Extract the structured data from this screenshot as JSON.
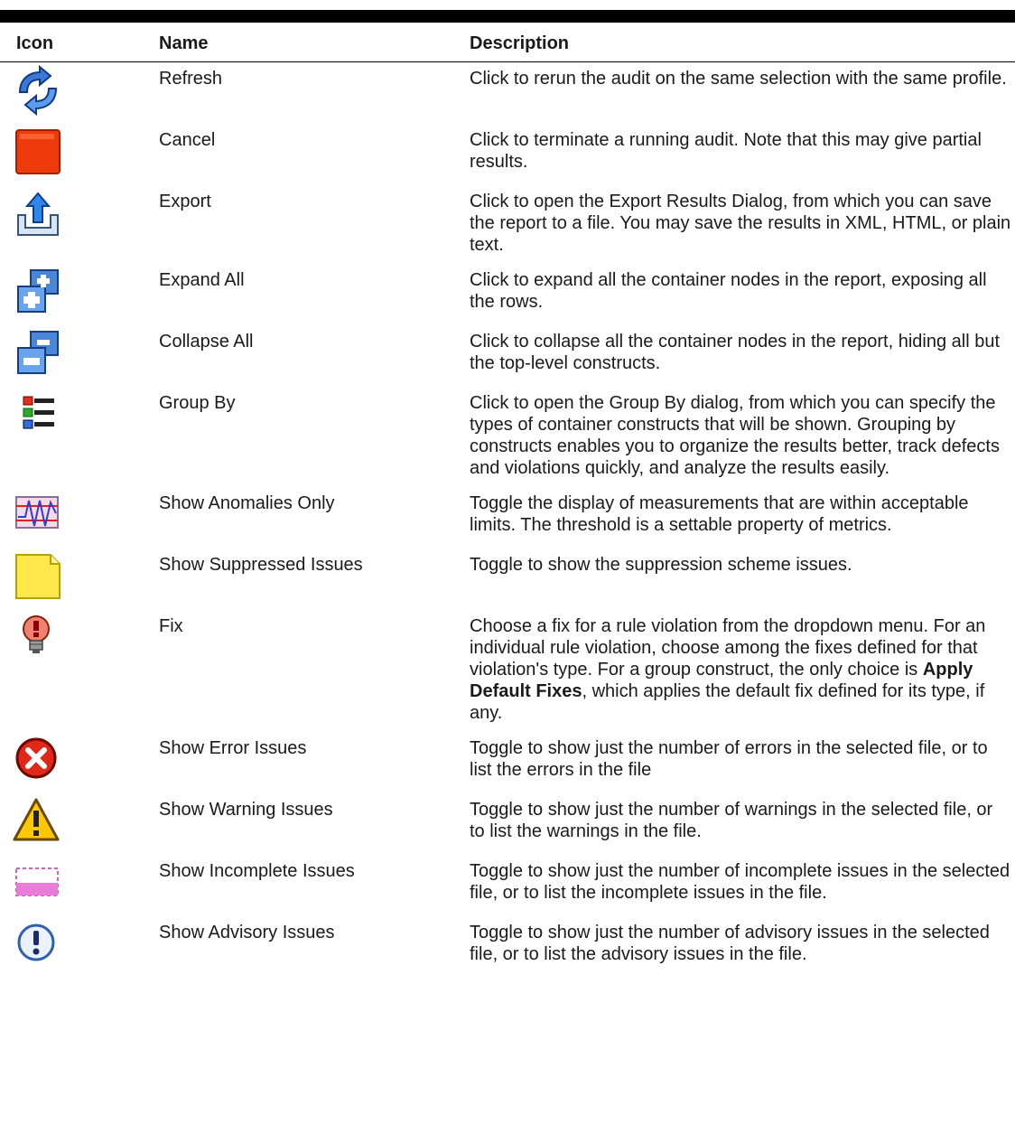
{
  "headers": {
    "icon": "Icon",
    "name": "Name",
    "description": "Description"
  },
  "rows": [
    {
      "icon": "refresh-icon",
      "name": "Refresh",
      "description": "Click to rerun the audit on the same selection with the same profile."
    },
    {
      "icon": "cancel-icon",
      "name": "Cancel",
      "description": "Click to terminate a running audit. Note that this may give partial results."
    },
    {
      "icon": "export-icon",
      "name": "Export",
      "description": "Click to open the Export Results Dialog, from which you can save the report to a file. You may save the results in XML, HTML, or plain text."
    },
    {
      "icon": "expand-all-icon",
      "name": "Expand All",
      "description": "Click to expand all the container nodes in the report, exposing all the rows."
    },
    {
      "icon": "collapse-all-icon",
      "name": "Collapse All",
      "description": "Click to collapse all the container nodes in the report, hiding all but the top-level constructs."
    },
    {
      "icon": "group-by-icon",
      "name": "Group By",
      "description": "Click to open the Group By dialog, from which you can specify the types of container constructs that will be shown. Grouping by constructs enables you to organize the results better, track defects and violations quickly, and analyze the results easily."
    },
    {
      "icon": "anomalies-icon",
      "name": "Show Anomalies Only",
      "description": "Toggle the display of measurements that are within acceptable limits. The threshold is a settable property of metrics."
    },
    {
      "icon": "suppressed-note-icon",
      "name": "Show Suppressed Issues",
      "description": "Toggle to show the suppression scheme issues."
    },
    {
      "icon": "fix-bulb-icon",
      "name": "Fix",
      "description_before": "Choose a fix for a rule violation from the dropdown menu. For an individual rule violation, choose among the fixes defined for that violation's type. For a group construct, the only choice is ",
      "description_bold": "Apply Default Fixes",
      "description_after": ", which applies the default fix defined for its type, if any."
    },
    {
      "icon": "error-icon",
      "name": "Show Error Issues",
      "description": "Toggle to show just the number of errors in the selected file, or to list the errors in the file"
    },
    {
      "icon": "warning-icon",
      "name": "Show Warning Issues",
      "description": "Toggle to show just the number of warnings in the selected file, or to list the warnings in the file."
    },
    {
      "icon": "incomplete-icon",
      "name": "Show Incomplete Issues",
      "description": "Toggle to show just the number of incomplete issues in the selected file, or to list the incomplete issues in the file."
    },
    {
      "icon": "advisory-icon",
      "name": "Show Advisory Issues",
      "description": "Toggle to show just the number of advisory issues in the selected file, or to list the advisory issues in the file."
    }
  ]
}
